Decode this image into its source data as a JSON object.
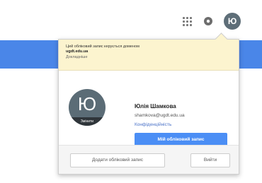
{
  "header": {
    "apps_icon": "apps-grid-icon",
    "settings_icon": "notifications-icon",
    "avatar_initial": "Ю"
  },
  "popup": {
    "notice": {
      "line1": "Цей обліковий запис керується доменом",
      "line2": "ugdt.edu.ua",
      "link": "Докладніше"
    },
    "profile": {
      "avatar_initial": "Ю",
      "avatar_caption": "Змінити",
      "name": "Юлія Шамкова",
      "email": "shamkova@ugdt.edu.ua",
      "privacy_link": "Конфіденційність",
      "account_button": "Мій обліковий запис"
    },
    "footer": {
      "add_account": "Додати обліковий запис",
      "sign_out": "Вийти"
    }
  },
  "colors": {
    "accent_blue": "#4a86e8",
    "button_blue": "#4b8ef5",
    "notice_bg": "#fcf4cf",
    "avatar_bg": "#5b6c76"
  }
}
